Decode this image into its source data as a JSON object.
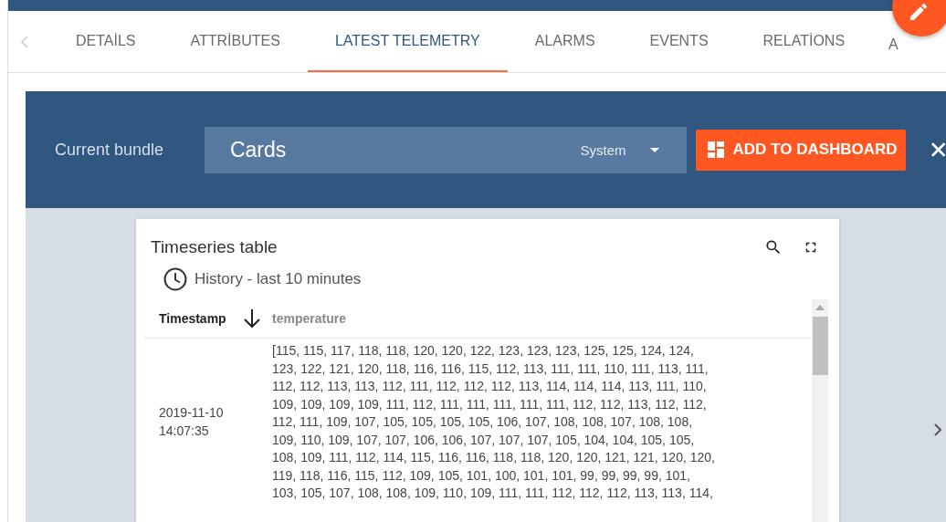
{
  "tabs": [
    {
      "label": "DETAİLS",
      "selected": false
    },
    {
      "label": "ATTRİBUTES",
      "selected": false
    },
    {
      "label": "LATEST TELEMETRY",
      "selected": true
    },
    {
      "label": "ALARMS",
      "selected": false
    },
    {
      "label": "EVENTS",
      "selected": false
    },
    {
      "label": "RELATİONS",
      "selected": false
    },
    {
      "label": "A",
      "selected": false
    }
  ],
  "bundle_bar": {
    "label": "Current bundle",
    "bundle": "Cards",
    "scope": "System",
    "add_button": "ADD TO DASHBOARD"
  },
  "widget": {
    "title": "Timeseries table",
    "timewindow": "History - last 10 minutes",
    "columns": [
      {
        "label": "Timestamp",
        "sorted": true
      },
      {
        "label": "temperature",
        "sorted": false
      }
    ],
    "rows": [
      {
        "timestamp": "2019-11-10 14:07:35",
        "temperature": "[115, 115, 117, 118, 118, 120, 120, 122, 123, 123, 123, 125, 125, 124, 124, 123, 122, 121, 120, 118, 116, 116, 115, 112, 113, 111, 111, 110, 111, 113, 111, 112, 112, 113, 113, 112, 111, 112, 112, 112, 113, 114, 114, 114, 113, 111, 110, 109, 109, 109, 109, 111, 112, 111, 111, 111, 111, 111, 112, 112, 113, 112, 112, 112, 111, 109, 107, 105, 105, 105, 105, 106, 107, 108, 108, 107, 108, 108, 109, 110, 109, 107, 107, 106, 106, 107, 107, 107, 105, 104, 104, 105, 105, 108, 109, 111, 112, 114, 115, 116, 116, 118, 118, 120, 120, 121, 121, 120, 120, 119, 118, 116, 115, 112, 109, 105, 101, 100, 101, 101, 99, 99, 99, 99, 101, 103, 105, 107, 108, 108, 109, 110, 109, 111, 111, 112, 112, 112, 113, 113, 114,"
      }
    ]
  }
}
